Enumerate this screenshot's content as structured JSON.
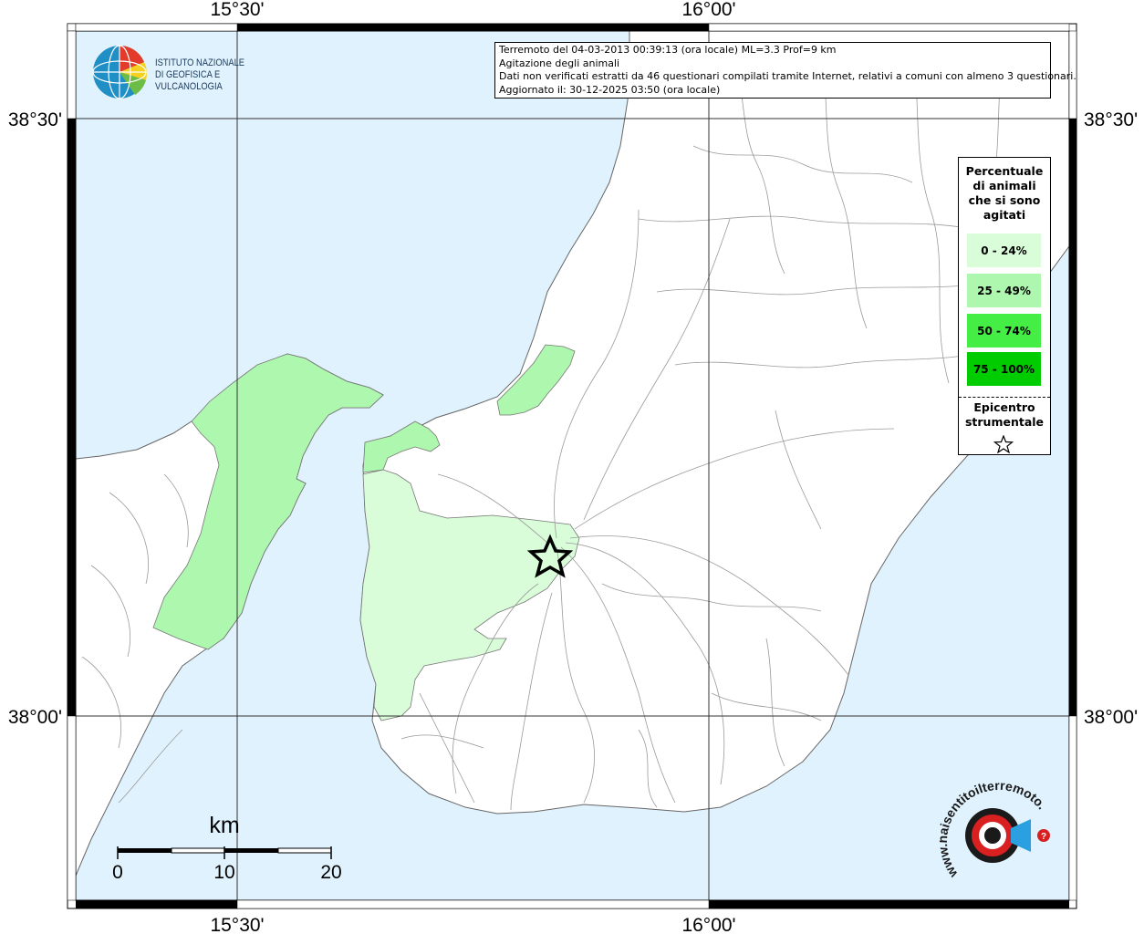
{
  "info": {
    "line1": "Terremoto del 04-03-2013 00:39:13 (ora locale) ML=3.3 Prof=9 km",
    "line2": "Agitazione degli animali",
    "line3": "Dati non verificati estratti da 46 questionari compilati tramite Internet, relativi a comuni con almeno 3 questionari.",
    "line4": "Aggiornato il: 30-12-2025 03:50 (ora locale)"
  },
  "axes": {
    "lon_left": "15°30'",
    "lon_right": "16°00'",
    "lat_top": "38°30'",
    "lat_bottom": "38°00'"
  },
  "logo": {
    "line1": "ISTITUTO NAZIONALE",
    "line2": "DI GEOFISICA E VULCANOLOGIA"
  },
  "legend": {
    "title_lines": [
      "Percentuale",
      "di animali",
      "che si sono",
      "agitati"
    ],
    "items": [
      {
        "label": "0 - 24%",
        "color": "#d9fcd9"
      },
      {
        "label": "25 - 49%",
        "color": "#aef7ae"
      },
      {
        "label": "50 - 74%",
        "color": "#44ee44"
      },
      {
        "label": "75 - 100%",
        "color": "#00cc00"
      }
    ],
    "epicenter_lines": [
      "Epicentro",
      "strumentale"
    ]
  },
  "scale": {
    "unit": "km",
    "ticks": [
      "0",
      "10",
      "20"
    ]
  },
  "watermark": {
    "text": "www.haisentitoilterremoto.it"
  },
  "colors": {
    "sea": "#e0f2fd",
    "land": "#ffffff",
    "border": "#9a9a9a",
    "pale_green": "#d9fcd9",
    "light_green": "#aef7ae"
  }
}
